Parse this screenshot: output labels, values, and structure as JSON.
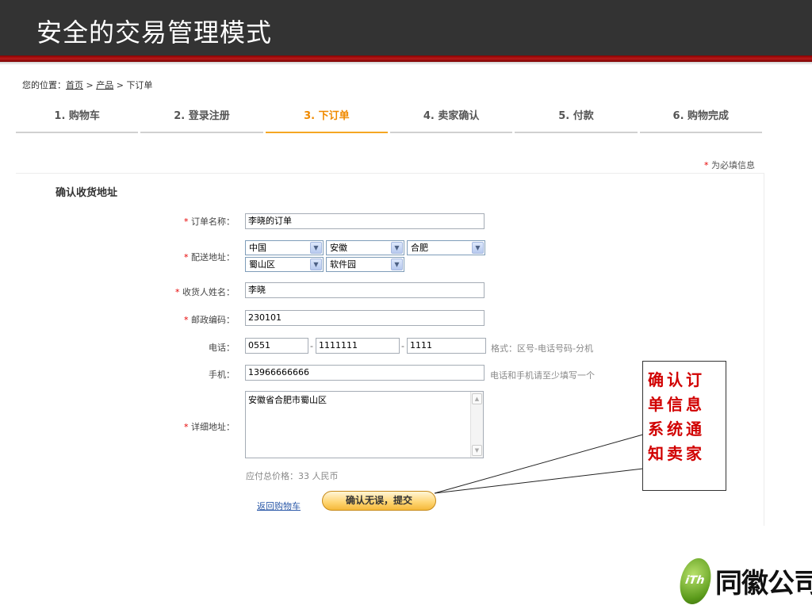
{
  "slide": {
    "title": "安全的交易管理模式"
  },
  "breadcrumb": {
    "prefix": "您的位置：",
    "home": "首页",
    "sep1": " > ",
    "product": "产品",
    "sep2": " > ",
    "current": "下订单"
  },
  "steps": [
    {
      "label": "1. 购物车"
    },
    {
      "label": "2. 登录注册"
    },
    {
      "label": "3. 下订单"
    },
    {
      "label": "4. 卖家确认"
    },
    {
      "label": "5. 付款"
    },
    {
      "label": "6. 购物完成"
    }
  ],
  "active_step": 3,
  "required_note": {
    "star": "*",
    "text": " 为必填信息"
  },
  "section_title": "确认收货地址",
  "form": {
    "order_name": {
      "label": "订单名称：",
      "required": true,
      "value": "李晓的订单"
    },
    "address": {
      "label": "配送地址：",
      "required": true,
      "country": "中国",
      "province": "安徽",
      "city": "合肥",
      "district": "蜀山区",
      "area": "软件园"
    },
    "receiver": {
      "label": "收货人姓名：",
      "required": true,
      "value": "李晓"
    },
    "postcode": {
      "label": "邮政编码：",
      "required": true,
      "value": "230101"
    },
    "phone": {
      "label": "电话：",
      "required": false,
      "area_code": "0551",
      "number": "1111111",
      "ext": "1111",
      "dash": "-",
      "hint": "格式：区号-电话号码-分机"
    },
    "mobile": {
      "label": "手机：",
      "required": false,
      "value": "13966666666",
      "hint": "电话和手机请至少填写一个"
    },
    "detail": {
      "label": "详细地址：",
      "required": true,
      "value": "安徽省合肥市蜀山区"
    },
    "price": "应付总价格：33 人民币",
    "back_link": "返回购物车",
    "submit": "确认无误，提交"
  },
  "callout": {
    "lines": [
      "确认订",
      "单信息",
      "系统通",
      "知卖家"
    ],
    "color": "#d10000"
  },
  "logo": {
    "mark": "iTh",
    "text": "同徽公司"
  },
  "colors": {
    "title_bar": "#333333",
    "stripe": "#b41a1a",
    "active_step": "#f08a00",
    "required": "#e60000"
  }
}
